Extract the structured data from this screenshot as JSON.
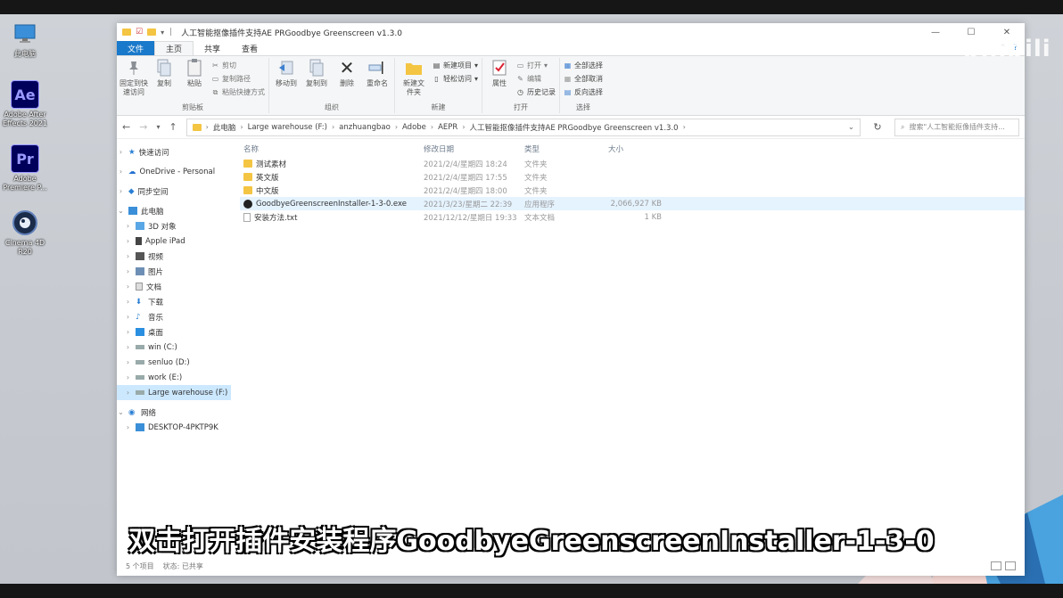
{
  "desktop": {
    "icons": [
      {
        "label": "此电脑",
        "glyph": ""
      },
      {
        "label": "Adobe After Effects 2021",
        "glyph": "Ae"
      },
      {
        "label": "Adobe Premiere P...",
        "glyph": "Pr"
      },
      {
        "label": "Cinema 4D R20",
        "glyph": ""
      }
    ]
  },
  "watermark": "bilibili",
  "window": {
    "title": "人工智能抠像插件支持AE PRGoodbye Greenscreen v1.3.0",
    "tabs": {
      "file": "文件",
      "home": "主页",
      "share": "共享",
      "view": "查看"
    },
    "ribbon": {
      "clipboard": {
        "group": "剪贴板",
        "pin": "固定到快速访问",
        "copy": "复制",
        "paste": "粘贴",
        "cut": "剪切",
        "copy_path": "复制路径",
        "paste_shortcut": "粘贴快捷方式"
      },
      "organize": {
        "group": "组织",
        "move_to": "移动到",
        "copy_to": "复制到",
        "delete": "删除",
        "rename": "重命名"
      },
      "new": {
        "group": "新建",
        "new_folder": "新建文件夹",
        "new_item": "新建项目",
        "easy_access": "轻松访问"
      },
      "open": {
        "group": "打开",
        "properties": "属性",
        "open": "打开",
        "edit": "编辑",
        "history": "历史记录"
      },
      "select": {
        "group": "选择",
        "select_all": "全部选择",
        "select_none": "全部取消",
        "invert": "反向选择"
      }
    },
    "address": {
      "segments": [
        "此电脑",
        "Large warehouse (F:)",
        "anzhuangbao",
        "Adobe",
        "AEPR",
        "人工智能抠像插件支持AE PRGoodbye Greenscreen v1.3.0"
      ],
      "search_placeholder": "搜索\"人工智能抠像插件支持..."
    },
    "nav": {
      "quick_access": "快速访问",
      "onedrive": "OneDrive - Personal",
      "sync": "同步空间",
      "this_pc": "此电脑",
      "pc_items": [
        "3D 对象",
        "Apple iPad",
        "视频",
        "图片",
        "文档",
        "下载",
        "音乐",
        "桌面",
        "win (C:)",
        "senluo (D:)",
        "work (E:)",
        "Large warehouse (F:)"
      ],
      "network": "网络",
      "network_items": [
        "DESKTOP-4PKTP9K"
      ]
    },
    "columns": {
      "name": "名称",
      "date": "修改日期",
      "type": "类型",
      "size": "大小"
    },
    "files": [
      {
        "name": "测试素材",
        "date": "2021/2/4/星期四 18:24",
        "type": "文件夹",
        "size": "",
        "kind": "folder"
      },
      {
        "name": "英文版",
        "date": "2021/2/4/星期四 17:55",
        "type": "文件夹",
        "size": "",
        "kind": "folder"
      },
      {
        "name": "中文版",
        "date": "2021/2/4/星期四 18:00",
        "type": "文件夹",
        "size": "",
        "kind": "folder"
      },
      {
        "name": "GoodbyeGreenscreenInstaller-1-3-0.exe",
        "date": "2021/3/23/星期二 22:39",
        "type": "应用程序",
        "size": "2,066,927 KB",
        "kind": "exe"
      },
      {
        "name": "安装方法.txt",
        "date": "2021/12/12/星期日 19:33",
        "type": "文本文档",
        "size": "1 KB",
        "kind": "txt"
      }
    ],
    "status": {
      "count": "5 个项目",
      "state": "状态: 已共享"
    }
  },
  "subtitle": "双击打开插件安装程序GoodbyeGreenscreenInstaller-1-3-0",
  "colors": {
    "accent": "#1979ca",
    "folder": "#f4c542",
    "selection": "#cce8ff"
  }
}
